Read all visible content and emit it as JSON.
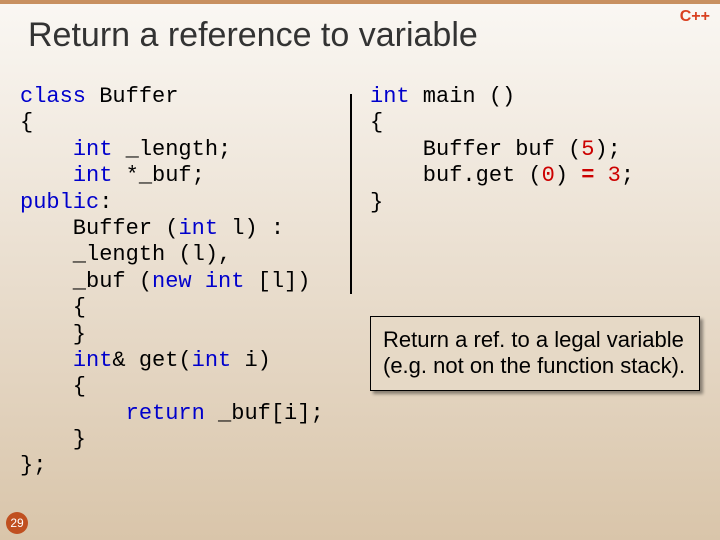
{
  "badge": "C++",
  "title": "Return a reference to variable",
  "code_left": {
    "l1a": "class",
    "l1b": " Buffer",
    "l2": "{",
    "l3a": "int",
    "l3b": " _length;",
    "l4a": "int",
    "l4b": " *_buf;",
    "l5a": "public",
    "l5b": ":",
    "l6a": "    Buffer (",
    "l6b": "int",
    "l6c": " l) :",
    "l7": "    _length (l),",
    "l8a": "    _buf (",
    "l8b": "new int",
    "l8c": " [l])",
    "l9": "    {",
    "l10": "    }",
    "l11a": "int",
    "l11b": "& get(",
    "l11c": "int",
    "l11d": " i)",
    "l12": "    {",
    "l13a": "return",
    "l13b": " _buf[i];",
    "l14": "    }",
    "l15": "};"
  },
  "code_right": {
    "l1a": "int",
    "l1b": " main ()",
    "l2": "{",
    "l3a": "    Buffer buf (",
    "l3b": "5",
    "l3c": ");",
    "l4a": "    buf.get (",
    "l4b": "0",
    "l4c": ") ",
    "l4d": "=",
    "l4e": " ",
    "l4f": "3",
    "l4g": ";",
    "l5": "}"
  },
  "note": "Return a ref. to a legal variable (e.g. not on the function stack).",
  "slide_number": "29"
}
